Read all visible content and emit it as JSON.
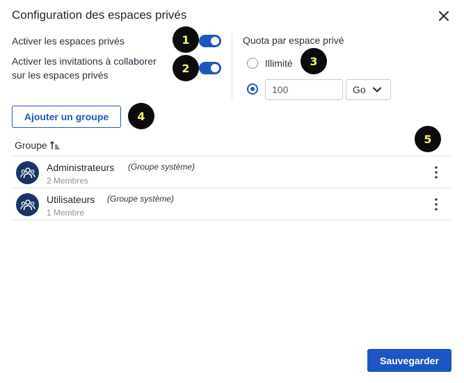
{
  "dialog": {
    "title": "Configuration des espaces privés"
  },
  "settings": {
    "enable_private_spaces": {
      "label": "Activer les espaces privés",
      "enabled": true
    },
    "enable_invitations": {
      "label": "Activer les invitations à collaborer sur les espaces privés",
      "enabled": true
    }
  },
  "quota": {
    "title": "Quota par espace privé",
    "unlimited_label": "Illimité",
    "unlimited_selected": false,
    "custom_selected": true,
    "value": "100",
    "unit": "Go"
  },
  "actions": {
    "add_group_label": "Ajouter un groupe",
    "save_label": "Sauvegarder"
  },
  "table": {
    "column_header": "Groupe",
    "rows": [
      {
        "name": "Administrateurs",
        "tag": "(Groupe système)",
        "members": "2 Membres"
      },
      {
        "name": "Utilisateurs",
        "tag": "(Groupe système)",
        "members": "1 Membre"
      }
    ]
  },
  "annotations": [
    "1",
    "2",
    "3",
    "4",
    "5"
  ],
  "colors": {
    "accent": "#1d56c4",
    "avatar": "#1b3466",
    "badge_bg": "#0b0b0b",
    "badge_text": "#f2ef6a"
  }
}
